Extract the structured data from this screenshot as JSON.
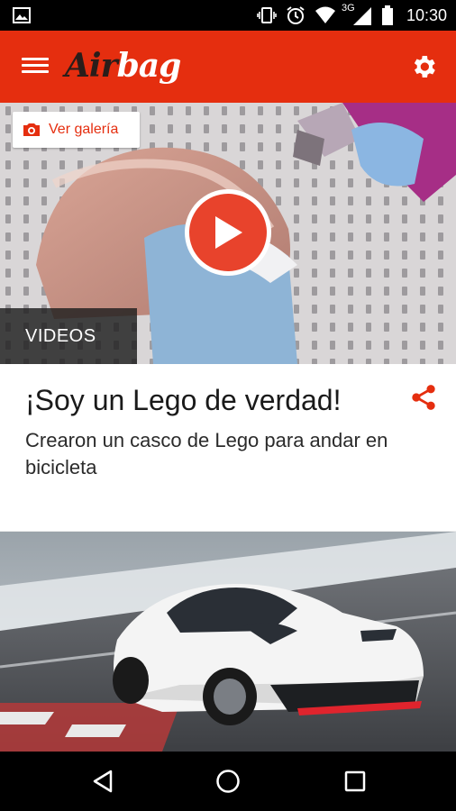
{
  "status_bar": {
    "time": "10:30",
    "network": "3G"
  },
  "app_bar": {
    "logo_part1": "Air",
    "logo_part2": "bag",
    "accent_color": "#e52e0f"
  },
  "article": {
    "gallery_label": "Ver galería",
    "category": "VIDEOS",
    "title": "¡Soy un Lego de verdad!",
    "subtitle": "Crearon un casco de Lego para andar en bicicleta"
  },
  "icons": {
    "menu": "hamburger-menu-icon",
    "settings": "gear-icon",
    "camera": "camera-icon",
    "play": "play-icon",
    "share": "share-icon",
    "nav_back": "back-triangle-icon",
    "nav_home": "home-circle-icon",
    "nav_recents": "recents-square-icon"
  }
}
